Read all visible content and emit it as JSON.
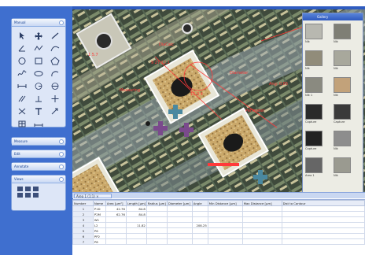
{
  "sidebar": {
    "tools_title": "Manual",
    "measure_title": "Measure",
    "edit_title": "Edit",
    "annotate_title": "Annotate",
    "views_title": "Views"
  },
  "image_window": {
    "title": "Area 1 (1:1)",
    "tab_label": "Area 1 (1:1) ×",
    "labels": [
      "1 5.7",
      "9 27 12.1",
      "15 3.4",
      "DiaCalc",
      "Diameter",
      "Perimeter",
      "Measuring",
      "Ang: 0.65"
    ]
  },
  "gallery": {
    "title": "Gallery",
    "thumbs": [
      {
        "caption": "Nik",
        "color": "#b8b8b0"
      },
      {
        "caption": "Nik",
        "color": "#7f7f75"
      },
      {
        "caption": "Nik",
        "color": "#918c7a"
      },
      {
        "caption": "Nik",
        "color": "#a8a89c"
      },
      {
        "caption": "Nik 1",
        "color": "#8a8a80"
      },
      {
        "caption": "Nik",
        "color": "#c2a27a"
      },
      {
        "caption": "Capture",
        "color": "#2a2a2a"
      },
      {
        "caption": "Capture",
        "color": "#3a3a3a"
      },
      {
        "caption": "Capture",
        "color": "#222"
      },
      {
        "caption": "Nik",
        "color": "#8d8d8d"
      },
      {
        "caption": "Area 1",
        "color": "#666"
      },
      {
        "caption": "Nik",
        "color": "#9a9a90"
      }
    ]
  },
  "table": {
    "headers": [
      "Number",
      "Name",
      "Area [µm²]",
      "Length [µm]",
      "Radius [µm]",
      "Diameter [µm]",
      "Angle",
      "Min Distance [µm]",
      "Max Distance [µm]",
      "Dist to Contour"
    ],
    "rows": [
      [
        "1",
        "P1D",
        "42.76",
        "84.8",
        "",
        "",
        "",
        "",
        "",
        ""
      ],
      [
        "2",
        "P2M",
        "62.76",
        "84.8",
        "",
        "",
        "",
        "",
        "",
        ""
      ],
      [
        "3",
        "W1",
        "",
        "",
        "",
        "",
        "",
        "",
        "",
        ""
      ],
      [
        "4",
        "L2",
        "",
        "11.82",
        "",
        "",
        "208.25",
        "",
        "",
        ""
      ],
      [
        "5",
        "P6",
        "",
        "",
        "",
        "",
        "",
        "",
        "",
        ""
      ],
      [
        "6",
        "PP2",
        "",
        "",
        "",
        "",
        "",
        "",
        "",
        ""
      ],
      [
        "7",
        "P8",
        "",
        "",
        "",
        "",
        "",
        "",
        "",
        ""
      ]
    ]
  },
  "colors": {
    "sidebar": "#3f6fcf",
    "title_bar": "#2f5cc0",
    "annotation": "#ff3a3a"
  }
}
